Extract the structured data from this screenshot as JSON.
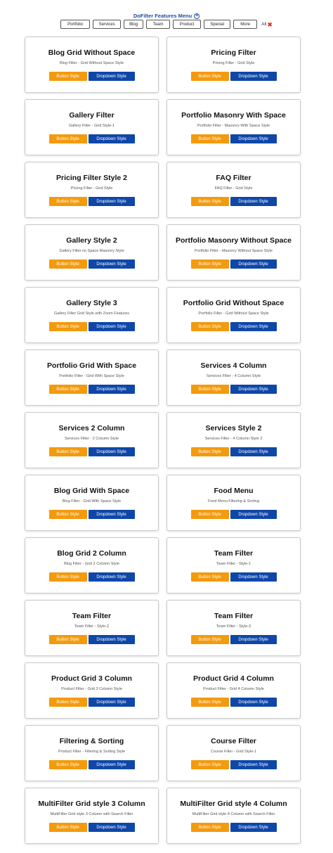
{
  "header": {
    "title": "DoFilter Features Menu",
    "plus_icon": "+"
  },
  "filters": {
    "items": [
      "Portfolio",
      "Services",
      "Blog",
      "Team",
      "Product",
      "Special",
      "More"
    ],
    "all_label": "All",
    "close_icon": "✖"
  },
  "buttons": {
    "button_style": "Button Style",
    "dropdown_style": "Dropdown Style"
  },
  "colors": {
    "accent_orange": "#f39a0d",
    "accent_blue": "#0f47a8",
    "close_red": "#e2231a"
  },
  "cards": [
    {
      "title": "Blog Grid Without Space",
      "subtitle": "Blog Filter - Grid Without Space Style"
    },
    {
      "title": "Pricing Filter",
      "subtitle": "Pricing Filter - Grid Style"
    },
    {
      "title": "Gallery Filter",
      "subtitle": "Gallery Filter - Grid Style-1"
    },
    {
      "title": "Portfolio Masonry With Space",
      "subtitle": "Portfolio Filter - Masonry With Space Style"
    },
    {
      "title": "Pricing Filter Style 2",
      "subtitle": "Pricing Filter - Grid Style"
    },
    {
      "title": "FAQ Filter",
      "subtitle": "FAQ Filter - Grid Style"
    },
    {
      "title": "Gallery Style 2",
      "subtitle": "Gallery Filter no Space Masonry Style"
    },
    {
      "title": "Portfolio Masonry Without Space",
      "subtitle": "Portfolio Filter - Masonry Without Space Style"
    },
    {
      "title": "Gallery Style 3",
      "subtitle": "Gallery Filter Grid Style with Zoom Features"
    },
    {
      "title": "Portfolio Grid Without Space",
      "subtitle": "Portfolio Filter - Grid Without Space Style"
    },
    {
      "title": "Portfolio Grid With Space",
      "subtitle": "Portfolio Filter - Grid With Space Style"
    },
    {
      "title": "Services 4 Column",
      "subtitle": "Services Filter - 4 Column Style"
    },
    {
      "title": "Services 2 Column",
      "subtitle": "Services Filter - 2 Column Style"
    },
    {
      "title": "Services Style 2",
      "subtitle": "Services Filter - 4 Column Style 2"
    },
    {
      "title": "Blog Grid With Space",
      "subtitle": "Blog Filter - Grid With Space Style"
    },
    {
      "title": "Food Menu",
      "subtitle": "Food Menu Filtering & Sorting"
    },
    {
      "title": "Blog Grid 2 Column",
      "subtitle": "Blog Filter - Grid 2 Column Style"
    },
    {
      "title": "Team Filter",
      "subtitle": "Team Filter - Style-1"
    },
    {
      "title": "Team Filter",
      "subtitle": "Team Filter - Style-2"
    },
    {
      "title": "Team Filter",
      "subtitle": "Team Filter - Style-3"
    },
    {
      "title": "Product Grid 3 Column",
      "subtitle": "Product Filter - Grid 3 Column Style"
    },
    {
      "title": "Product Grid 4 Column",
      "subtitle": "Product Filter - Grid 4 Column Style"
    },
    {
      "title": "Filtering & Sorting",
      "subtitle": "Product Filter - Filtering & Sorting Style"
    },
    {
      "title": "Course Filter",
      "subtitle": "Course Filter - Grid Style-1"
    },
    {
      "title": "MultiFilter Grid style 3 Column",
      "subtitle": "MultiFilter Grid style 3 Column with Search Filter"
    },
    {
      "title": "MultiFilter Grid style 4 Column",
      "subtitle": "MultiFilter Grid style 4 Column with Search Filter"
    }
  ]
}
